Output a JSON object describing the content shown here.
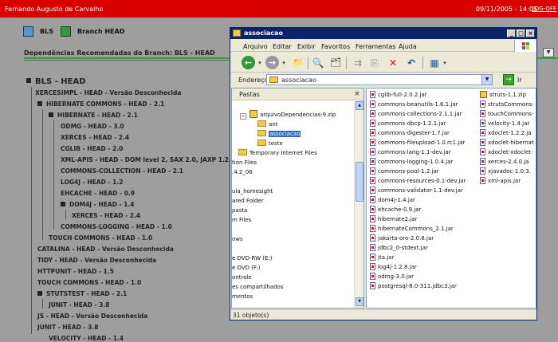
{
  "topbar": {
    "user": "Fernando Augusto de Carvalho",
    "datetime": "09/11/2005 - 14:05",
    "logoff": "LOG-OFF"
  },
  "tabs": [
    {
      "label": "BLS"
    },
    {
      "label": "Branch HEAD"
    }
  ],
  "section_title": "Dependências Recomendadas do Branch: BLS - HEAD",
  "tree": [
    {
      "label": "BLS - HEAD"
    },
    {
      "label": "XERCESIMPL - HEAD - Versão Desconhecida"
    },
    {
      "label": "HIBERNATE COMMONS - HEAD - 2.1"
    },
    {
      "label": "HIBERNATE - HEAD - 2.1"
    },
    {
      "label": "ODMG - HEAD - 3.0"
    },
    {
      "label": "XERCES - HEAD - 2.4"
    },
    {
      "label": "CGLIB - HEAD - 2.0"
    },
    {
      "label": "XML-APIS - HEAD - DOM level 2, SAX 2.0, JAXP 1.2"
    },
    {
      "label": "COMMONS-COLLECTION - HEAD - 2.1"
    },
    {
      "label": "LOG4J - HEAD - 1.2"
    },
    {
      "label": "EHCACHE - HEAD - 0.9"
    },
    {
      "label": "DOM4J - HEAD - 1.4"
    },
    {
      "label": "XERCES - HEAD - 2.4"
    },
    {
      "label": "COMMONS-LOGGING - HEAD - 1.0"
    },
    {
      "label": "TOUCH COMMONS - HEAD - 1.0"
    },
    {
      "label": "CATALINA - HEAD - Versão Desconhecida"
    },
    {
      "label": "TIDY - HEAD - Versão Desconhecida"
    },
    {
      "label": "HTTPUNIT - HEAD - 1.5"
    },
    {
      "label": "TOUCH COMMONS - HEAD - 1.0"
    },
    {
      "label": "STUTSTEST - HEAD - 2.1"
    },
    {
      "label": "JUNIT - HEAD - 3.8"
    },
    {
      "label": "JS - HEAD - Versão Desconhecida"
    },
    {
      "label": "JUNIT - HEAD - 3.8"
    },
    {
      "label": "VELOCITY - HEAD - 1.4"
    }
  ],
  "explorer": {
    "title": "associacao",
    "menu": [
      "Arquivo",
      "Editar",
      "Exibir",
      "Favoritos",
      "Ferramentas",
      "Ajuda"
    ],
    "address_label": "Endereço",
    "address_value": "associacao",
    "go_label": "Ir",
    "pane_title": "Pastas",
    "folders": [
      "arquivoDependencias-9.zip",
      "ant",
      "associacao",
      "teste",
      "Temporary Internet Files",
      "tion Files",
      ".4.2_06",
      "",
      "ula_homesight",
      "ared Folder",
      "pasta",
      "m Files",
      "",
      "ows",
      "",
      "e DVD-RW (E:)",
      "e DVD (F:)",
      "ontrole",
      "es compartilhados",
      "mentos",
      ""
    ],
    "files_col1": [
      "cglib-full-2.0.2.jar",
      "commons-beanutils-1.6.1.jar",
      "commons-collections-2.1.1.jar",
      "commons-dbcp-1.2.1.jar",
      "commons-digester-1.7.jar",
      "commons-fileupload-1.0.rc1.jar",
      "commons-lang-1.1-dev.jar",
      "commons-logging-1.0.4.jar",
      "commons-pool-1.2.jar",
      "commons-resources-0.1-dev.jar",
      "commons-validator-1.1-dev.jar",
      "dom4j-1.4.jar",
      "ehcache-0.9.jar",
      "hibernate2.jar",
      "hibernateCommons_2.1.jar",
      "jakarta-oro-2.0.8.jar",
      "jdbc2_0-stdext.jar",
      "jta.jar",
      "log4j-1.2.8.jar",
      "odmg-3.0.jar",
      "postgresql-8.0-311.jdbc3.jar"
    ],
    "files_col2": [
      "struts-1.1.zip",
      "strutsCommons-",
      "touchCommons-",
      "velocity-1.4.jar",
      "xdoclet-1.2.2.ja",
      "xdoclet-hibernat",
      "xdoclet-xdoclet-",
      "xerces-2.4.0.ja",
      "xjavadoc-1.0.3.",
      "xml-apis.jar"
    ],
    "status": "31 objeto(s)"
  }
}
